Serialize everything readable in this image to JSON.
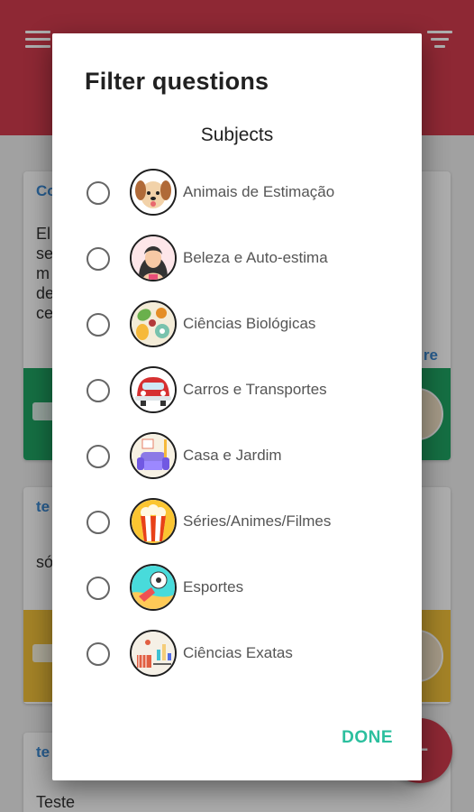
{
  "dialog": {
    "title": "Filter questions",
    "section_title": "Subjects",
    "done_label": "DONE",
    "accent_color": "#2bbf9e",
    "subjects": [
      {
        "label": "Animais de Estimação",
        "icon": "dog-icon",
        "selected": false
      },
      {
        "label": "Beleza e Auto-estima",
        "icon": "woman-icon",
        "selected": false
      },
      {
        "label": "Ciências Biológicas",
        "icon": "biology-icon",
        "selected": false
      },
      {
        "label": "Carros e Transportes",
        "icon": "car-icon",
        "selected": false
      },
      {
        "label": "Casa e Jardim",
        "icon": "armchair-icon",
        "selected": false
      },
      {
        "label": "Séries/Animes/Filmes",
        "icon": "popcorn-icon",
        "selected": false
      },
      {
        "label": "Esportes",
        "icon": "soccer-icon",
        "selected": false
      },
      {
        "label": "Ciências Exatas",
        "icon": "math-icon",
        "selected": false
      }
    ]
  },
  "background": {
    "app_bar_color": "#d13b4d",
    "cards": [
      {
        "title": "Co",
        "body": "El\nse\nm\nde\nce",
        "more": "re",
        "band_color": "#1fa463"
      },
      {
        "title": "te",
        "body": "só",
        "more": "",
        "band_color": "#f2c23a"
      },
      {
        "title": "te",
        "body": "Teste",
        "more": "",
        "band_color": ""
      }
    ],
    "fab_label": "+"
  }
}
